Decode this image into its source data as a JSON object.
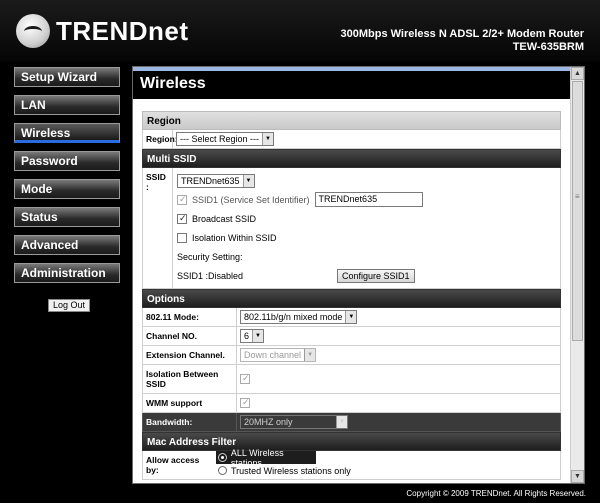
{
  "header": {
    "brand": "TRENDnet",
    "product_line1": "300Mbps Wireless N ADSL 2/2+ Modem Router",
    "product_line2": "TEW-635BRM"
  },
  "sidebar": {
    "items": [
      {
        "label": "Setup Wizard"
      },
      {
        "label": "LAN"
      },
      {
        "label": "Wireless"
      },
      {
        "label": "Password"
      },
      {
        "label": "Mode"
      },
      {
        "label": "Status"
      },
      {
        "label": "Advanced"
      },
      {
        "label": "Administration"
      }
    ],
    "logout_label": "Log Out"
  },
  "main": {
    "title": "Wireless",
    "region": {
      "heading": "Region",
      "label": "Region:",
      "value": "--- Select Region ---"
    },
    "multi_ssid": {
      "heading": "Multi SSID",
      "ssid_label": "SSID :",
      "ssid_value": "TRENDnet635",
      "ssid1_label": "SSID1 (Service Set Identifier)",
      "ssid1_value": "TRENDnet635",
      "broadcast_label": "Broadcast SSID",
      "isolation_label": "Isolation Within SSID",
      "security_label": "Security Setting:",
      "status_text": "SSID1 :Disabled",
      "configure_button": "Configure SSID1"
    },
    "options": {
      "heading": "Options",
      "mode_label": "802.11 Mode:",
      "mode_value": "802.11b/g/n mixed mode",
      "channel_label": "Channel NO.",
      "channel_value": "6",
      "extension_label": "Extension Channel.",
      "extension_value": "Down channel",
      "isolation_label": "Isolation Between SSID",
      "wmm_label": "WMM support",
      "bandwidth_label": "Bandwidth:",
      "bandwidth_value": "20MHZ only"
    },
    "mac_filter": {
      "heading": "Mac Address Filter",
      "allow_label": "Allow access by:",
      "opt_all": "ALL Wireless stations",
      "opt_trusted": "Trusted Wireless stations only"
    }
  },
  "footer": {
    "copyright": "Copyright © 2009 TRENDnet. All Rights Reserved."
  }
}
